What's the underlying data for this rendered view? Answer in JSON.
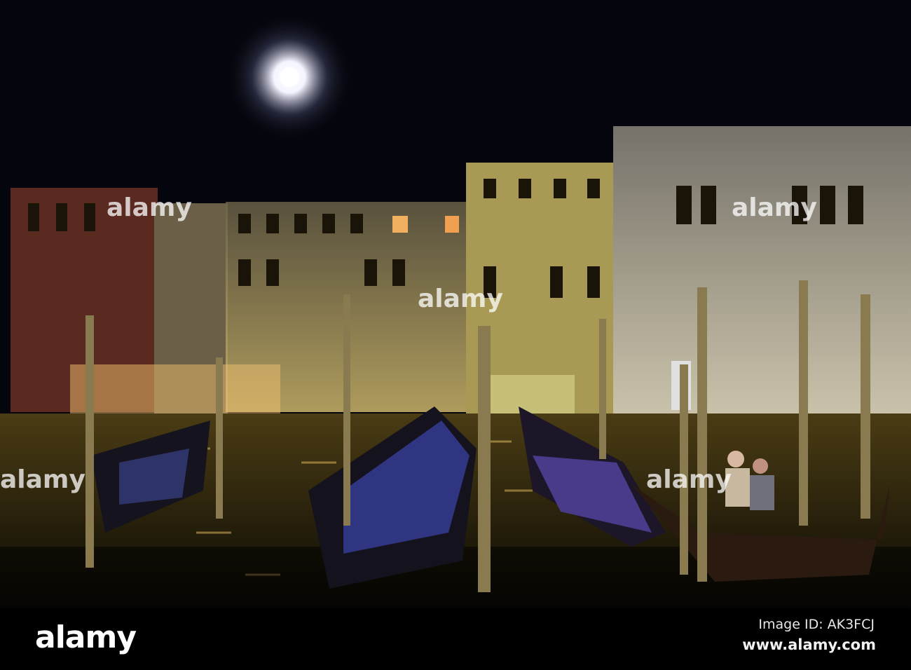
{
  "photo": {
    "subject": "Grand Canal at night with gondolas and full moon",
    "colors": {
      "sky": "#05060d",
      "water": "#2a2410",
      "facade_lit": "#c9b46a",
      "gondola_cover": "#3b3a8a"
    }
  },
  "watermark": {
    "text": "alamy"
  },
  "footer": {
    "logo": "alamy",
    "image_id": "Image ID: AK3FCJ",
    "site": "www.alamy.com"
  }
}
